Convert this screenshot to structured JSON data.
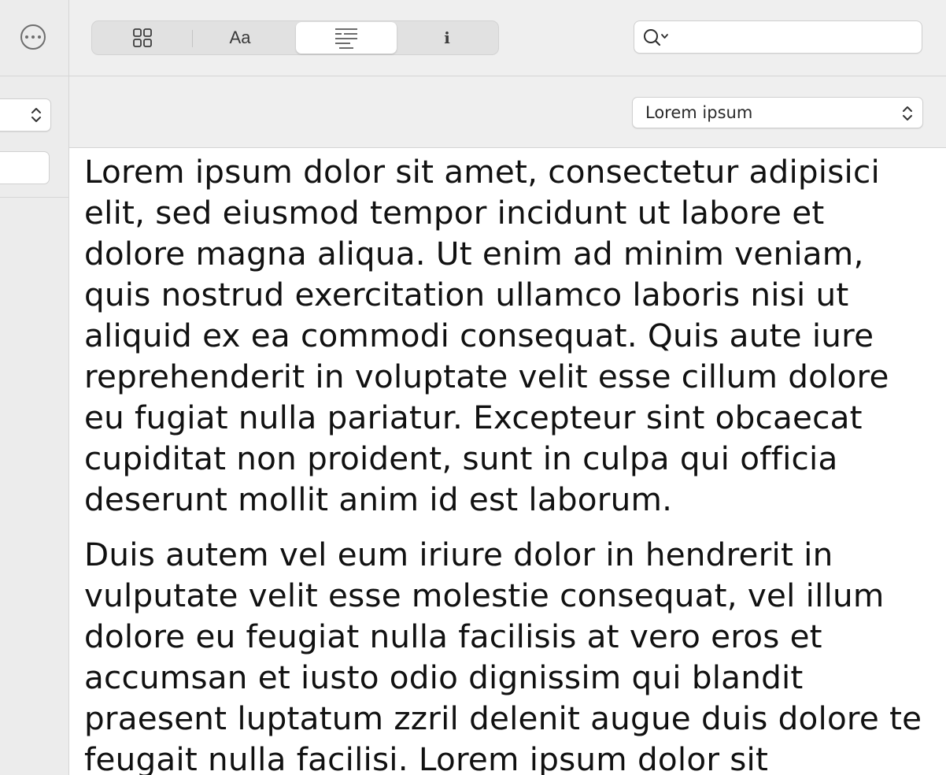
{
  "toolbar": {
    "segments": [
      {
        "name": "layout",
        "icon": "grid-icon",
        "active": false
      },
      {
        "name": "font",
        "label": "Aa",
        "active": false
      },
      {
        "name": "paragraph",
        "icon": "paragraph-format-icon",
        "active": true
      },
      {
        "name": "info",
        "label": "i",
        "active": false
      }
    ],
    "search": {
      "value": "",
      "placeholder": ""
    }
  },
  "format_bar": {
    "paragraph_style": "Lorem ipsum"
  },
  "document": {
    "paragraphs": [
      "Lorem ipsum dolor sit amet, consectetur adipisici elit, sed eiusmod tempor incidunt ut labore et dolore magna aliqua. Ut enim ad minim veniam, quis nostrud exercitation ullamco laboris nisi ut aliquid ex ea commodi consequat. Quis aute iure reprehenderit in voluptate velit esse cillum dolore eu fugiat nulla pariatur. Excepteur sint obcaecat cupiditat non proident, sunt in culpa qui officia deserunt mollit anim id est laborum.",
      "Duis autem vel eum iriure dolor in hendrerit in vulputate velit esse molestie consequat, vel illum dolore eu feugiat nulla facilisis at vero eros et accumsan et iusto odio dignissim qui blandit praesent luptatum zzril delenit augue duis dolore te feugait nulla facilisi. Lorem ipsum dolor sit"
    ]
  }
}
